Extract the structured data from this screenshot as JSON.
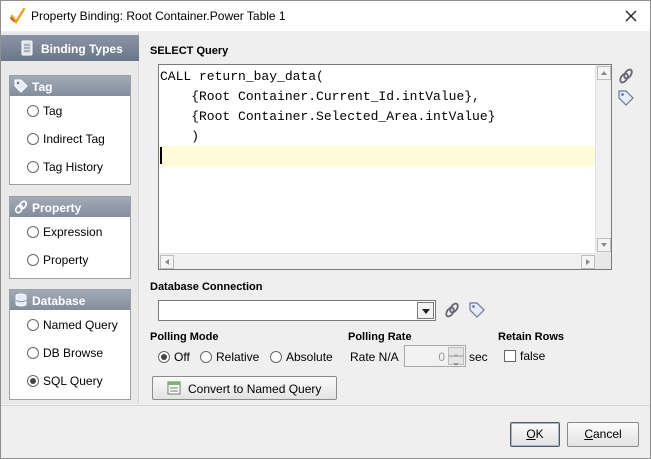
{
  "window": {
    "title": "Property Binding: Root Container.Power Table 1"
  },
  "sidebar": {
    "header": "Binding Types",
    "groups": [
      {
        "title": "Tag",
        "icon": "tag-icon",
        "items": [
          {
            "label": "Tag",
            "selected": false
          },
          {
            "label": "Indirect Tag",
            "selected": false
          },
          {
            "label": "Tag History",
            "selected": false
          }
        ]
      },
      {
        "title": "Property",
        "icon": "link-icon",
        "items": [
          {
            "label": "Expression",
            "selected": false
          },
          {
            "label": "Property",
            "selected": false
          }
        ]
      },
      {
        "title": "Database",
        "icon": "database-icon",
        "items": [
          {
            "label": "Named Query",
            "selected": false
          },
          {
            "label": "DB Browse",
            "selected": false
          },
          {
            "label": "SQL Query",
            "selected": true
          }
        ]
      }
    ]
  },
  "query": {
    "label": "SELECT Query",
    "lines": [
      "CALL return_bay_data(",
      "    {Root Container.Current_Id.intValue},",
      "    {Root Container.Selected_Area.intValue}",
      "    )",
      ""
    ]
  },
  "database_connection": {
    "label": "Database Connection",
    "value": ""
  },
  "polling_mode": {
    "label": "Polling Mode",
    "options": [
      {
        "label": "Off",
        "selected": true
      },
      {
        "label": "Relative",
        "selected": false
      },
      {
        "label": "Absolute",
        "selected": false
      }
    ]
  },
  "polling_rate": {
    "label": "Polling Rate",
    "rate_label": "Rate N/A",
    "value": "0",
    "unit": "sec"
  },
  "retain_rows": {
    "label": "Retain Rows",
    "checked": false,
    "value_label": "false"
  },
  "convert_button": {
    "label": "Convert to Named Query"
  },
  "buttons": {
    "ok_prefix": "",
    "ok_mnemonic": "O",
    "ok_rest": "K",
    "cancel_mnemonic": "C",
    "cancel_rest": "ancel"
  }
}
